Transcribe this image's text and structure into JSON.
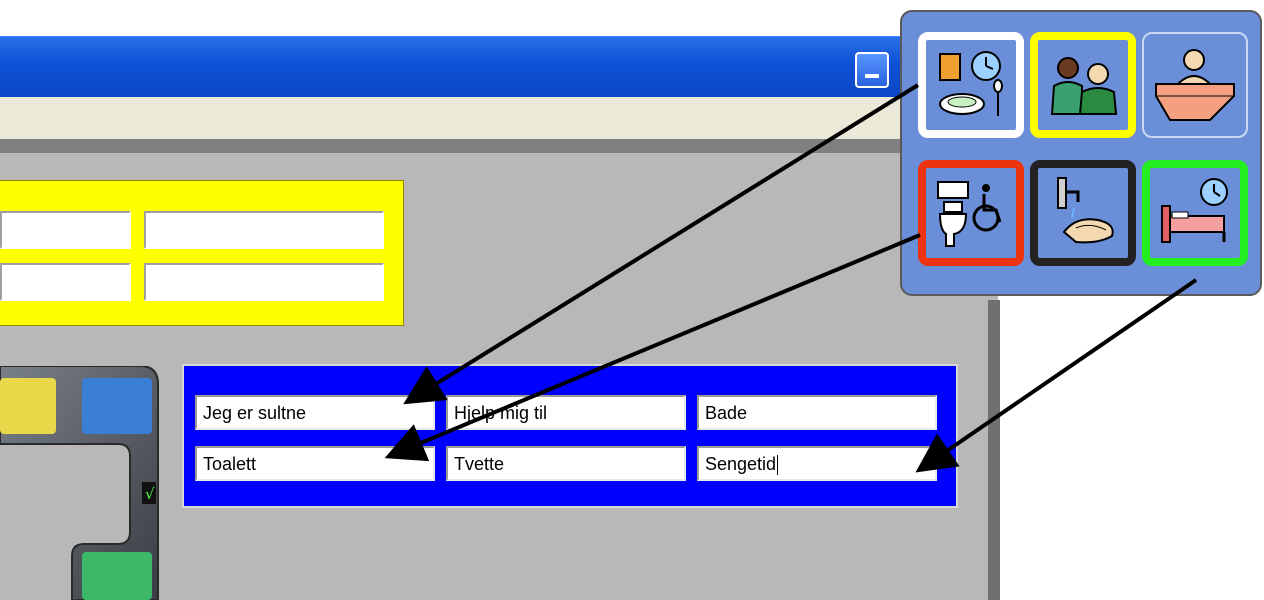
{
  "window": {
    "minimize_tooltip": "",
    "colors": {
      "titlebar": "#0f52d6",
      "menubar": "#ece9d8",
      "client": "#b8b8b8"
    }
  },
  "yellow_panel": {
    "color": "#ffff00",
    "fields": [
      "",
      "",
      "",
      ""
    ]
  },
  "blue_panel": {
    "color": "#0000ff",
    "fields": [
      "Jeg er sultne",
      "Hjelp mig til",
      "Bade",
      "Toalett",
      "Tvette",
      "Sengetid"
    ]
  },
  "device": {
    "buttons": [
      {
        "name": "yellow",
        "color": "#e8d84a"
      },
      {
        "name": "blue",
        "color": "#3a7ed8"
      },
      {
        "name": "green",
        "color": "#3cb868"
      }
    ],
    "check": "√"
  },
  "symbol_grid": {
    "cells": [
      {
        "icon": "food-drink-clock-icon",
        "border": "#ffffff"
      },
      {
        "icon": "helper-people-icon",
        "border": "#ffff00"
      },
      {
        "icon": "bathtub-icon",
        "border": "#6a8fd8"
      },
      {
        "icon": "toilet-wheelchair-icon",
        "border": "#ee3311"
      },
      {
        "icon": "washing-hands-icon",
        "border": "#222222"
      },
      {
        "icon": "bed-clock-icon",
        "border": "#22ee22"
      }
    ]
  }
}
